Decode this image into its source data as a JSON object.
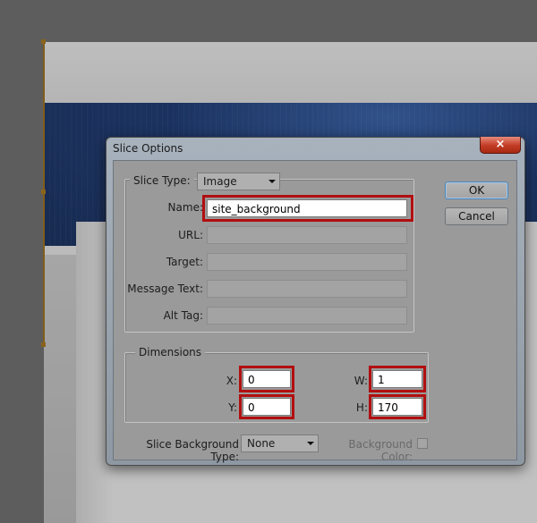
{
  "dialog": {
    "title": "Slice Options",
    "close_glyph": "×",
    "ok_label": "OK",
    "cancel_label": "Cancel"
  },
  "slice": {
    "type_label": "Slice Type:",
    "type_value": "Image",
    "name_label": "Name:",
    "name_value": "site_background",
    "url_label": "URL:",
    "url_value": "",
    "target_label": "Target:",
    "target_value": "",
    "message_label": "Message Text:",
    "message_value": "",
    "alt_label": "Alt Tag:",
    "alt_value": ""
  },
  "dimensions": {
    "legend": "Dimensions",
    "x_label": "X:",
    "x_value": "0",
    "y_label": "Y:",
    "y_value": "0",
    "w_label": "W:",
    "w_value": "1",
    "h_label": "H:",
    "h_value": "170"
  },
  "background": {
    "type_label": "Slice Background Type:",
    "type_value": "None",
    "color_label": "Background Color:"
  },
  "colors": {
    "highlight": "#b10f10",
    "banner": "#0f2f6e",
    "slice_guide": "#a8740d"
  }
}
